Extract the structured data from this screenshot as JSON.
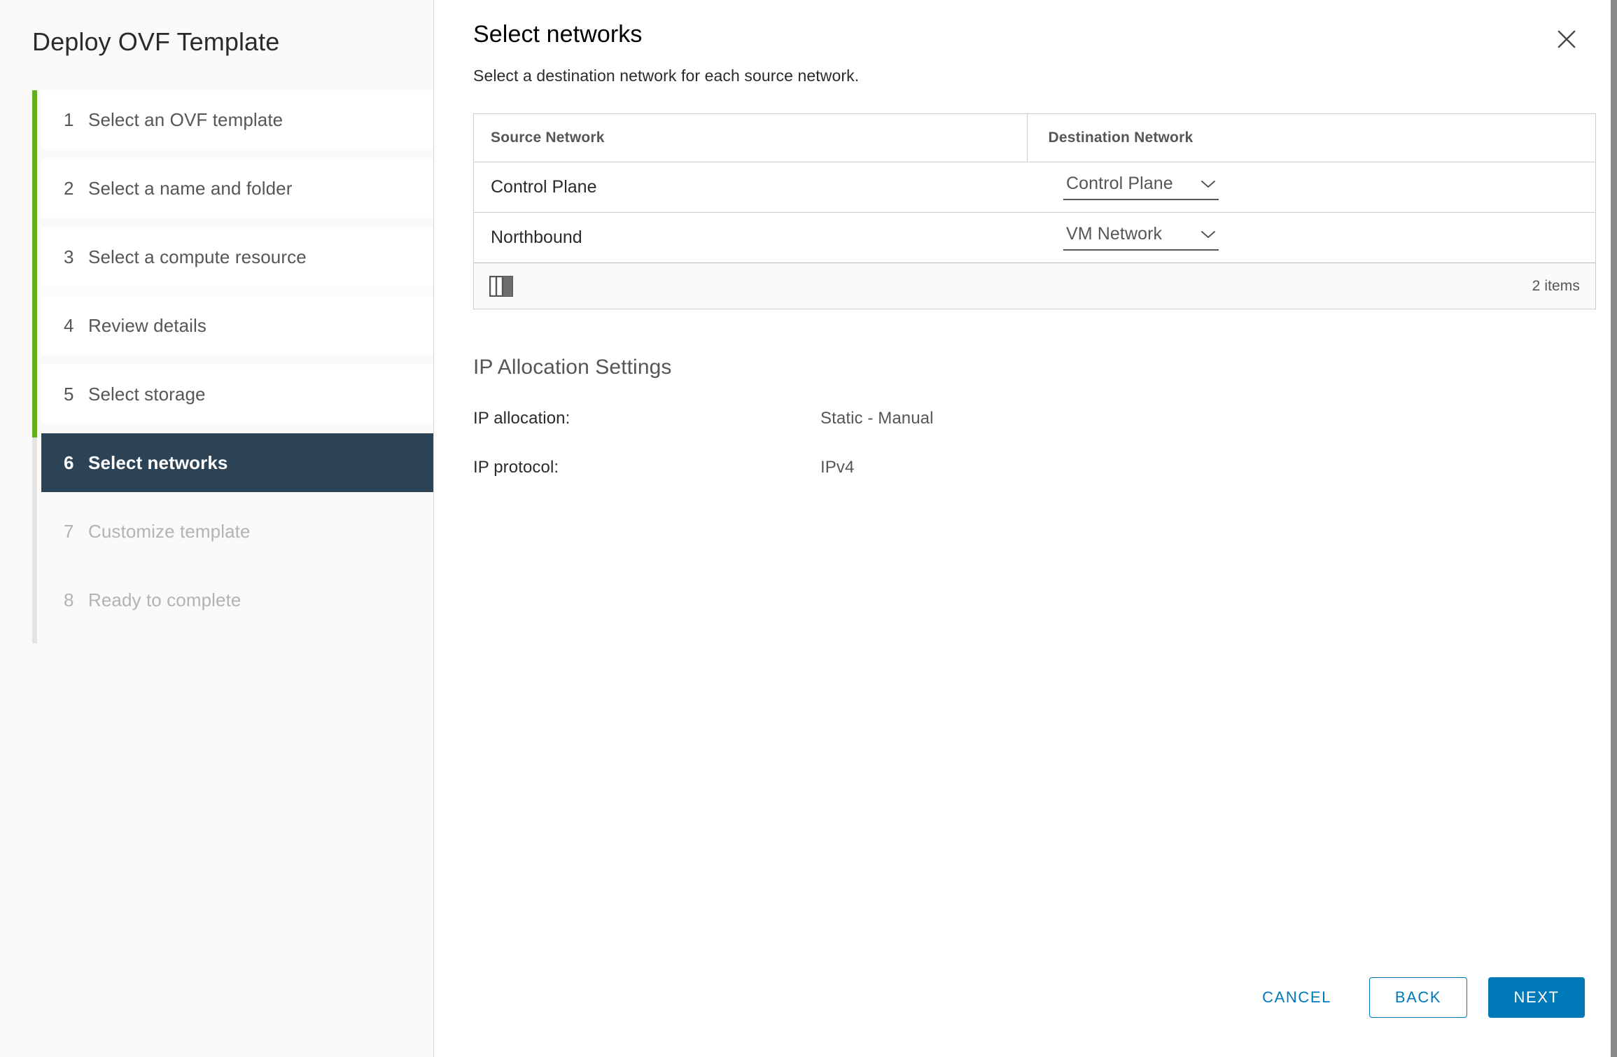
{
  "wizard": {
    "title": "Deploy OVF Template",
    "steps": [
      {
        "num": "1",
        "label": "Select an OVF template",
        "state": "complete"
      },
      {
        "num": "2",
        "label": "Select a name and folder",
        "state": "complete"
      },
      {
        "num": "3",
        "label": "Select a compute resource",
        "state": "complete"
      },
      {
        "num": "4",
        "label": "Review details",
        "state": "complete"
      },
      {
        "num": "5",
        "label": "Select storage",
        "state": "complete"
      },
      {
        "num": "6",
        "label": "Select networks",
        "state": "active"
      },
      {
        "num": "7",
        "label": "Customize template",
        "state": "disabled"
      },
      {
        "num": "8",
        "label": "Ready to complete",
        "state": "disabled"
      }
    ]
  },
  "main": {
    "title": "Select networks",
    "subtitle": "Select a destination network for each source network.",
    "close_icon": "close-icon"
  },
  "table": {
    "headers": {
      "source": "Source Network",
      "destination": "Destination Network"
    },
    "rows": [
      {
        "source": "Control Plane",
        "destination": "Control Plane"
      },
      {
        "source": "Northbound",
        "destination": "VM Network"
      }
    ],
    "footer": {
      "column_picker_icon": "columns-icon",
      "items_count": "2 items"
    }
  },
  "ip_allocation": {
    "section_title": "IP Allocation Settings",
    "rows": [
      {
        "label": "IP allocation:",
        "value": "Static - Manual"
      },
      {
        "label": "IP protocol:",
        "value": "IPv4"
      }
    ]
  },
  "footer": {
    "cancel": "CANCEL",
    "back": "BACK",
    "next": "NEXT"
  },
  "colors": {
    "accent_blue": "#0079b8",
    "progress_green": "#62b01e",
    "active_navy": "#2c4356",
    "text_dark": "#2b2b2b",
    "text_muted": "#565656",
    "text_disabled": "#b3b3b3",
    "border_gray": "#cccccc"
  }
}
